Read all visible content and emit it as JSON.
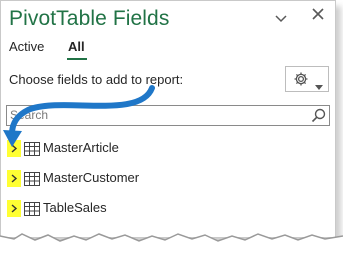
{
  "panel": {
    "title": "PivotTable Fields",
    "tabs": [
      {
        "label": "Active",
        "active": false
      },
      {
        "label": "All",
        "active": true
      }
    ],
    "choose_label": "Choose fields to add to report:",
    "tools_icon": "gear-icon",
    "search": {
      "placeholder": "Search",
      "icon": "search-icon"
    },
    "fields": [
      {
        "label": "MasterArticle",
        "icon": "table-icon"
      },
      {
        "label": "MasterCustomer",
        "icon": "table-icon"
      },
      {
        "label": "TableSales",
        "icon": "table-icon"
      }
    ]
  },
  "colors": {
    "title": "#217346",
    "highlight": "#ffff33",
    "arrow": "#1f77c8"
  }
}
